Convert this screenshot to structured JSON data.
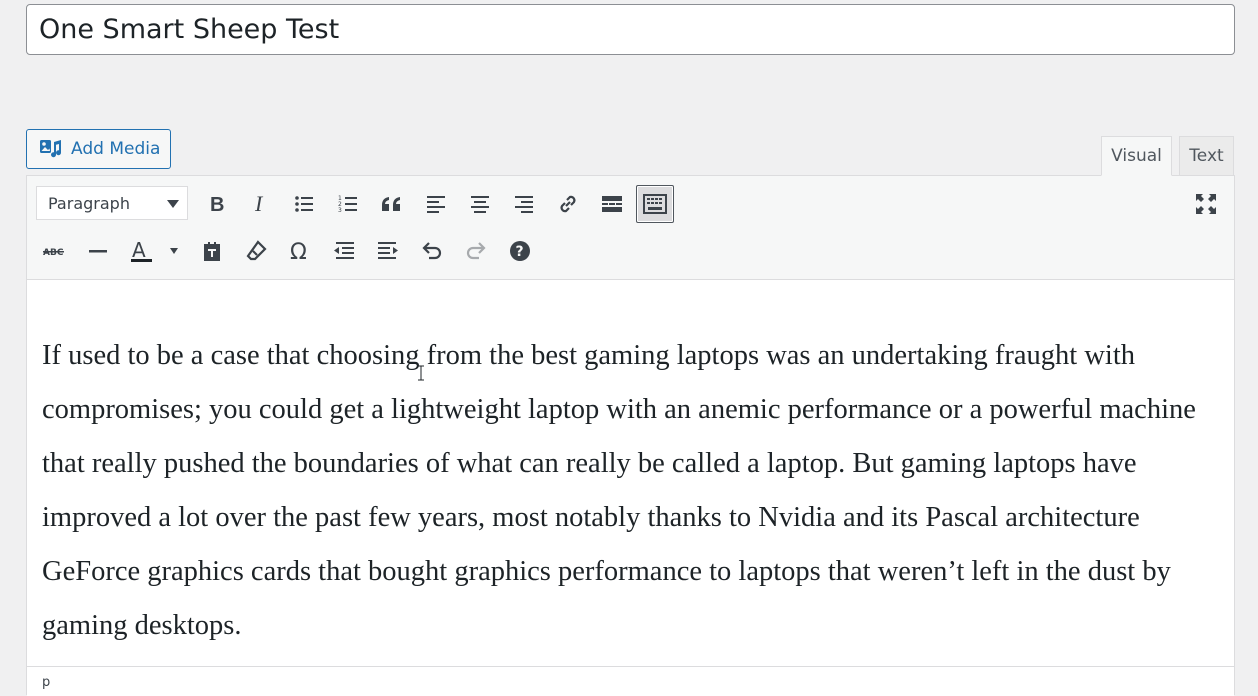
{
  "post": {
    "title": "One Smart Sheep Test"
  },
  "media": {
    "add_media_label": "Add Media"
  },
  "tabs": {
    "visual": "Visual",
    "text": "Text"
  },
  "toolbar": {
    "format_select_value": "Paragraph",
    "row1_icons": [
      "bold-icon",
      "italic-icon",
      "bulleted-list-icon",
      "numbered-list-icon",
      "blockquote-icon",
      "align-left-icon",
      "align-center-icon",
      "align-right-icon",
      "insert-link-icon",
      "read-more-icon",
      "toolbar-toggle-icon"
    ],
    "row2_icons": [
      "strikethrough-icon",
      "horizontal-line-icon",
      "text-color-icon",
      "paste-as-text-icon",
      "clear-formatting-icon",
      "special-character-icon",
      "decrease-indent-icon",
      "increase-indent-icon",
      "undo-icon",
      "redo-icon",
      "keyboard-shortcuts-icon"
    ],
    "fullscreen_icon": "fullscreen-icon"
  },
  "content": {
    "paragraph": "If used to be a case that choosing from the best gaming laptops was an undertaking fraught with compromises; you could get a lightweight laptop with an anemic performance or a powerful machine that really pushed the boundaries of what can really be called a laptop. But gaming laptops have improved a lot over the past few years, most notably thanks to Nvidia and its Pascal architecture GeForce graphics cards that bought graphics performance to laptops that weren’t left in the dust by gaming desktops."
  },
  "status": {
    "path": "p"
  },
  "colors": {
    "accent": "#2271b1",
    "background": "#f0f0f1",
    "toolbar_bg": "#f6f7f7",
    "text": "#1d2327"
  }
}
